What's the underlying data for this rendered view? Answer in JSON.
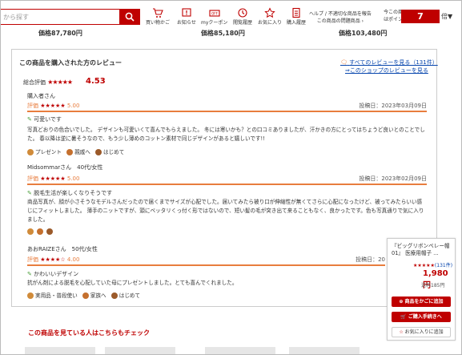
{
  "header": {
    "search_placeholder": "から探す",
    "nav": [
      {
        "label": "買い物かご"
      },
      {
        "label": "お知らせ"
      },
      {
        "label": "myクーポン"
      },
      {
        "label": "閲覧履歴"
      },
      {
        "label": "お気に入り"
      },
      {
        "label": "購入履歴"
      }
    ],
    "help_line1": "ヘルプ / 不適切な商品を報告",
    "help_line2": "この商品の問題商品 ›",
    "points_line1": "今この商品",
    "points_line2": "はポイント",
    "points_value": "7",
    "points_suffix": "倍▼"
  },
  "prices": [
    "価格87,780円",
    "価格85,180円",
    "価格103,480円"
  ],
  "reviews_section": {
    "title": "この商品を購入された方のレビュー",
    "link_all": "すべてのレビューを見る（131件）",
    "link_shop": "⇒このショップのレビューを見る",
    "overall_label": "総合評価",
    "overall_stars": "★★★★★",
    "overall_value": "4.53",
    "rating_label": "評価",
    "reviews": [
      {
        "user": "購入者さん",
        "stars": "★★★★★",
        "score": "5.00",
        "date": "投稿日：2023年03月09日",
        "headline": "可愛いです",
        "body": "写真どおりの色合いでした。 デザインも可愛いくて喜んでもらえました。 冬には寒いかも？との口コミありましたが、汗かきの方にとってはちょうど良いとのことでした。 春以降は逆に暑そうなので、もう少し薄めのコットン素材で同じデザインがあると嬉しいです!!",
        "tags": [
          "プレゼント",
          "親戚へ",
          "はじめて"
        ]
      },
      {
        "user": "Midsommarさん　40代/女性",
        "stars": "★★★★★",
        "score": "5.00",
        "date": "投稿日：2023年02月09日",
        "headline": "脱毛生活が楽しくなりそうです",
        "body": "商品写真が、顔が小さそうなモデルさんだったので届くまでサイズが心配でした。届いてみたら被り口が伸縮性が無くてさらに心配になったけど、被ってみたらいい感じにフィットしました。 薄手のニットですが、頭にベッタリくっ付く形ではないので、短い髪の毛が突き出て来ることもなく、良かったです。色も写真通りで気に入りました。",
        "tags": []
      },
      {
        "user": "あおRAIZEさん　50代/女性",
        "stars": "★★★★☆",
        "score": "4.00",
        "date": "投稿日：20",
        "headline": "かわいいデザイン",
        "body": "抗がん剤による脱毛を心配していた母にプレゼントしました。とても喜んでくれました。",
        "tags": [
          "実用品・普段使い",
          "家族へ",
          "はじめて"
        ]
      }
    ]
  },
  "see_also": "この商品を見ている人はこちらもチェック",
  "floating_panel": {
    "title": "『ビッグリボンベレー帽01』 医療用帽子 …",
    "stars": "★★★★★",
    "review_count": "(131件)",
    "price": "1,980円",
    "shipping": "送料185円",
    "add_cart": "商品をかごに追加",
    "buy_now": "ご購入手続きへ",
    "favorite": "お気に入りに追加"
  },
  "colors": {
    "accent": "#bf0000",
    "rating_bar": "#e87d3e",
    "link": "#0645ad"
  }
}
